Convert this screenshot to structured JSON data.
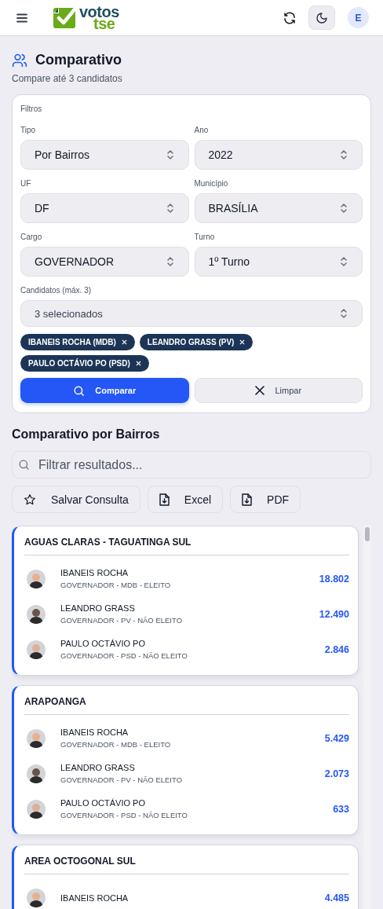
{
  "header": {
    "brand": [
      "votos",
      "tse"
    ],
    "avatar_initial": "E"
  },
  "page": {
    "title": "Comparativo",
    "subtitle": "Compare até 3 candidatos"
  },
  "filters": {
    "title": "Filtros",
    "fields": [
      {
        "label": "Tipo",
        "value": "Por Bairros"
      },
      {
        "label": "Ano",
        "value": "2022"
      },
      {
        "label": "UF",
        "value": "DF"
      },
      {
        "label": "Município",
        "value": "BRASÍLIA"
      },
      {
        "label": "Cargo",
        "value": "GOVERNADOR"
      },
      {
        "label": "Turno",
        "value": "1º Turno"
      }
    ],
    "candidates": {
      "label": "Candidatos (máx. 3)",
      "value": "3 selecionados"
    },
    "chips": [
      "IBANEIS ROCHA (MDB)",
      "LEANDRO GRASS (PV)",
      "PAULO OCTÁVIO PO (PSD)"
    ],
    "buttons": [
      {
        "label": "Comparar",
        "kind": "primary"
      },
      {
        "label": "Limpar",
        "kind": "secondary"
      }
    ]
  },
  "results": {
    "title": "Comparativo por Bairros",
    "search": {
      "placeholder": "Filtrar resultados..."
    },
    "actions": [
      {
        "label": "Salvar Consulta",
        "kind": "star"
      },
      {
        "label": "Excel",
        "kind": "file"
      },
      {
        "label": "PDF",
        "kind": "file"
      }
    ],
    "areas": [
      {
        "name": "AGUAS CLARAS - TAGUATINGA SUL",
        "candidates": [
          {
            "name": "IBANEIS ROCHA",
            "detail": "GOVERNADOR - MDB - ELEITO",
            "votes": "18.802"
          },
          {
            "name": "LEANDRO GRASS",
            "detail": "GOVERNADOR - PV - NÃO ELEITO",
            "votes": "12.490"
          },
          {
            "name": "PAULO OCTÁVIO PO",
            "detail": "GOVERNADOR - PSD - NÃO ELEITO",
            "votes": "2.846"
          }
        ]
      },
      {
        "name": "ARAPOANGA",
        "candidates": [
          {
            "name": "IBANEIS ROCHA",
            "detail": "GOVERNADOR - MDB - ELEITO",
            "votes": "5.429"
          },
          {
            "name": "LEANDRO GRASS",
            "detail": "GOVERNADOR - PV - NÃO ELEITO",
            "votes": "2.073"
          },
          {
            "name": "PAULO OCTÁVIO PO",
            "detail": "GOVERNADOR - PSD - NÃO ELEITO",
            "votes": "633"
          }
        ]
      },
      {
        "name": "AREA OCTOGONAL SUL",
        "candidates": [
          {
            "name": "IBANEIS ROCHA",
            "votes": "4.485"
          }
        ]
      }
    ]
  }
}
